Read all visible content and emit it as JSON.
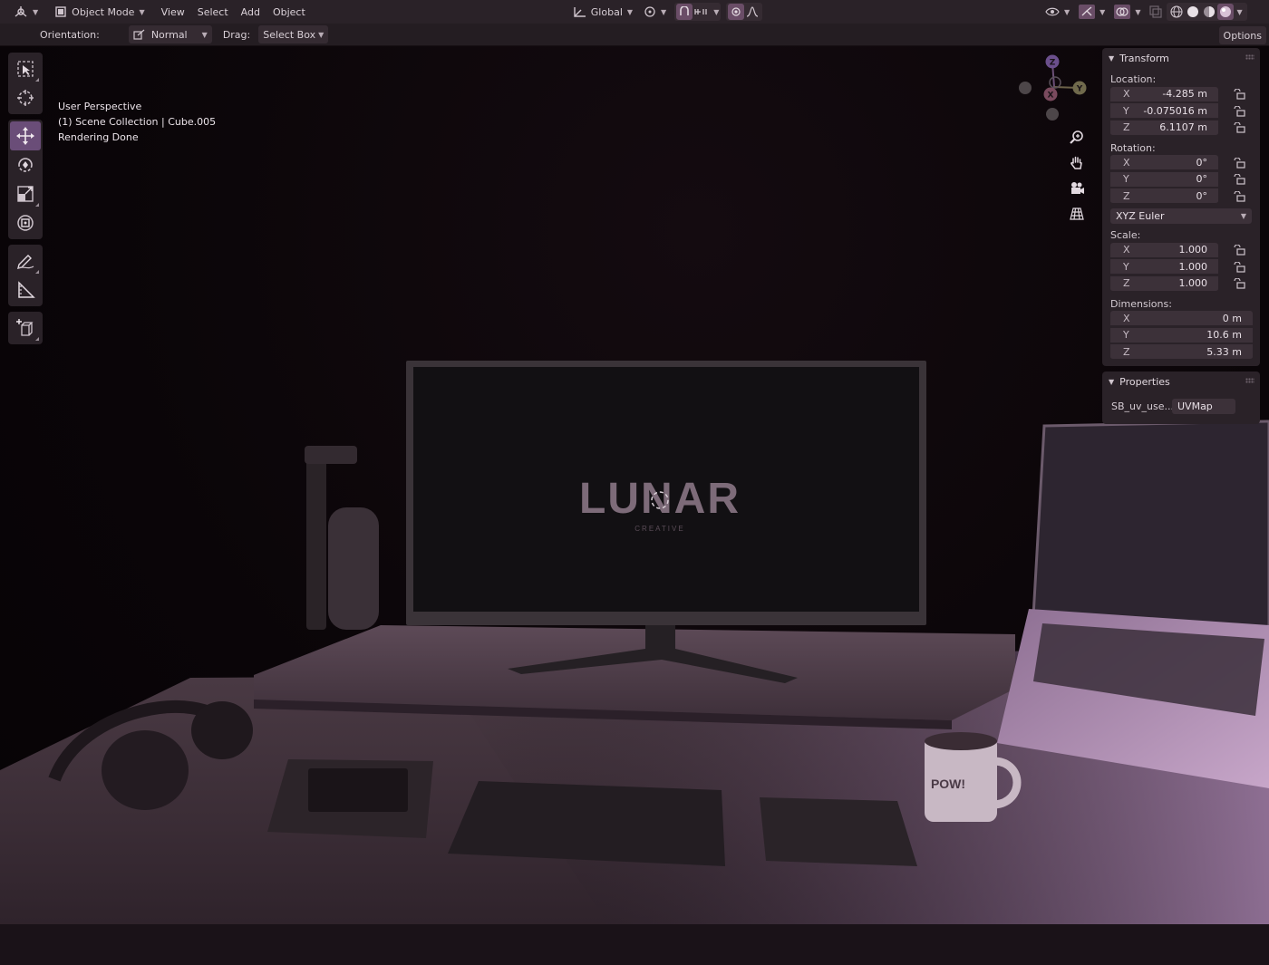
{
  "header": {
    "editor_type_icon": "3d-viewport-icon",
    "mode": "Object Mode",
    "menus": [
      "View",
      "Select",
      "Add",
      "Object"
    ],
    "transform_orientation": "Global",
    "options_label": "Options"
  },
  "subheader": {
    "orientation_label": "Orientation:",
    "orientation_value": "Normal",
    "drag_label": "Drag:",
    "drag_value": "Select Box"
  },
  "viewport": {
    "overlay_lines": [
      "User Perspective",
      "(1) Scene Collection | Cube.005",
      "Rendering Done"
    ],
    "gizmo_axes": [
      "Z",
      "Y",
      "X"
    ],
    "scene": {
      "monitor_logo": "LUNAR",
      "monitor_subtitle": "CREATIVE",
      "mug_text": "POW!"
    }
  },
  "toolbar": {
    "tools": [
      "select-box",
      "cursor",
      "move",
      "rotate",
      "scale",
      "transform",
      "annotate",
      "measure",
      "add-cube"
    ],
    "active_tool": "move"
  },
  "npanel": {
    "transform": {
      "title": "Transform",
      "location_label": "Location:",
      "location": [
        {
          "axis": "X",
          "value": "-4.285 m"
        },
        {
          "axis": "Y",
          "value": "-0.075016 m"
        },
        {
          "axis": "Z",
          "value": "6.1107 m"
        }
      ],
      "rotation_label": "Rotation:",
      "rotation": [
        {
          "axis": "X",
          "value": "0°"
        },
        {
          "axis": "Y",
          "value": "0°"
        },
        {
          "axis": "Z",
          "value": "0°"
        }
      ],
      "rotation_mode": "XYZ Euler",
      "scale_label": "Scale:",
      "scale": [
        {
          "axis": "X",
          "value": "1.000"
        },
        {
          "axis": "Y",
          "value": "1.000"
        },
        {
          "axis": "Z",
          "value": "1.000"
        }
      ],
      "dimensions_label": "Dimensions:",
      "dimensions": [
        {
          "axis": "X",
          "value": "0 m"
        },
        {
          "axis": "Y",
          "value": "10.6 m"
        },
        {
          "axis": "Z",
          "value": "5.33 m"
        }
      ]
    },
    "properties": {
      "title": "Properties",
      "prop_name": "SB_uv_use...",
      "prop_value": "UVMap"
    }
  },
  "colors": {
    "accent": "#6a4d78",
    "panel": "#2a2228",
    "field": "#3c3139",
    "tint": "#c9a0c7"
  }
}
